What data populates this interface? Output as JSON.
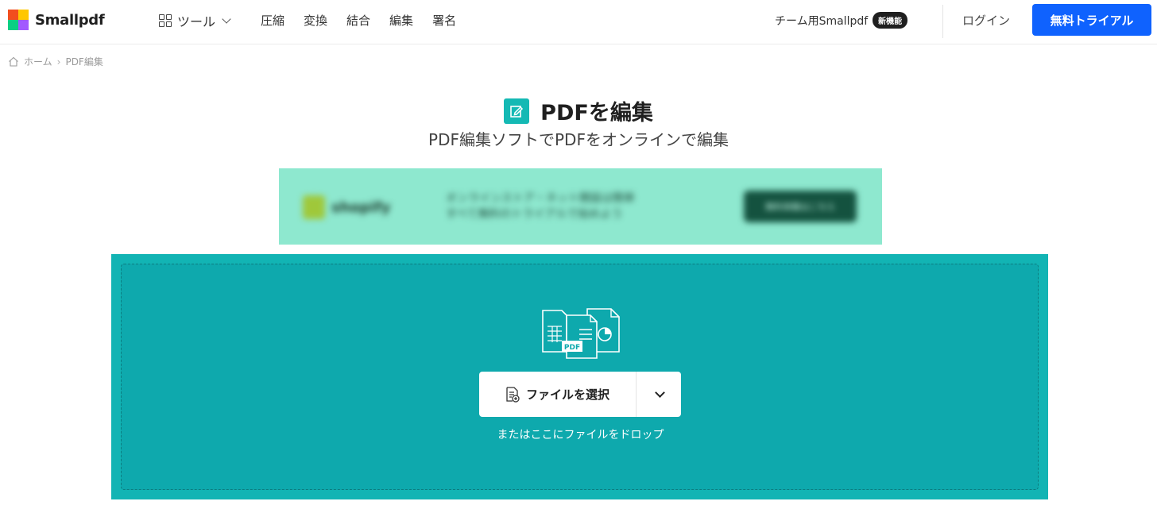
{
  "header": {
    "brand": "Smallpdf",
    "tools_label": "ツール",
    "nav": [
      "圧縮",
      "変換",
      "結合",
      "編集",
      "署名"
    ],
    "team_label": "チーム用Smallpdf",
    "new_badge": "新機能",
    "login_label": "ログイン",
    "trial_label": "無料トライアル"
  },
  "breadcrumb": {
    "home": "ホーム",
    "separator": "›",
    "current": "PDF編集"
  },
  "page": {
    "title": "PDFを編集",
    "subtitle": "PDF編集ソフトでPDFをオンラインで編集"
  },
  "ad": {
    "brand": "shopify",
    "text_line1": "オンラインストア・ネット開設は簡単",
    "text_line2": "すべて無料のトライアルで始めよう",
    "button": "無料体験はこちら"
  },
  "dropzone": {
    "choose_label": "ファイルを選択",
    "hint": "またはここにファイルをドロップ",
    "illustration_label": "PDF"
  },
  "colors": {
    "accent": "#0f62fe",
    "teal_outer": "#12b4b4",
    "teal_inner": "#0ea9ad",
    "title_icon": "#14b9b4"
  }
}
